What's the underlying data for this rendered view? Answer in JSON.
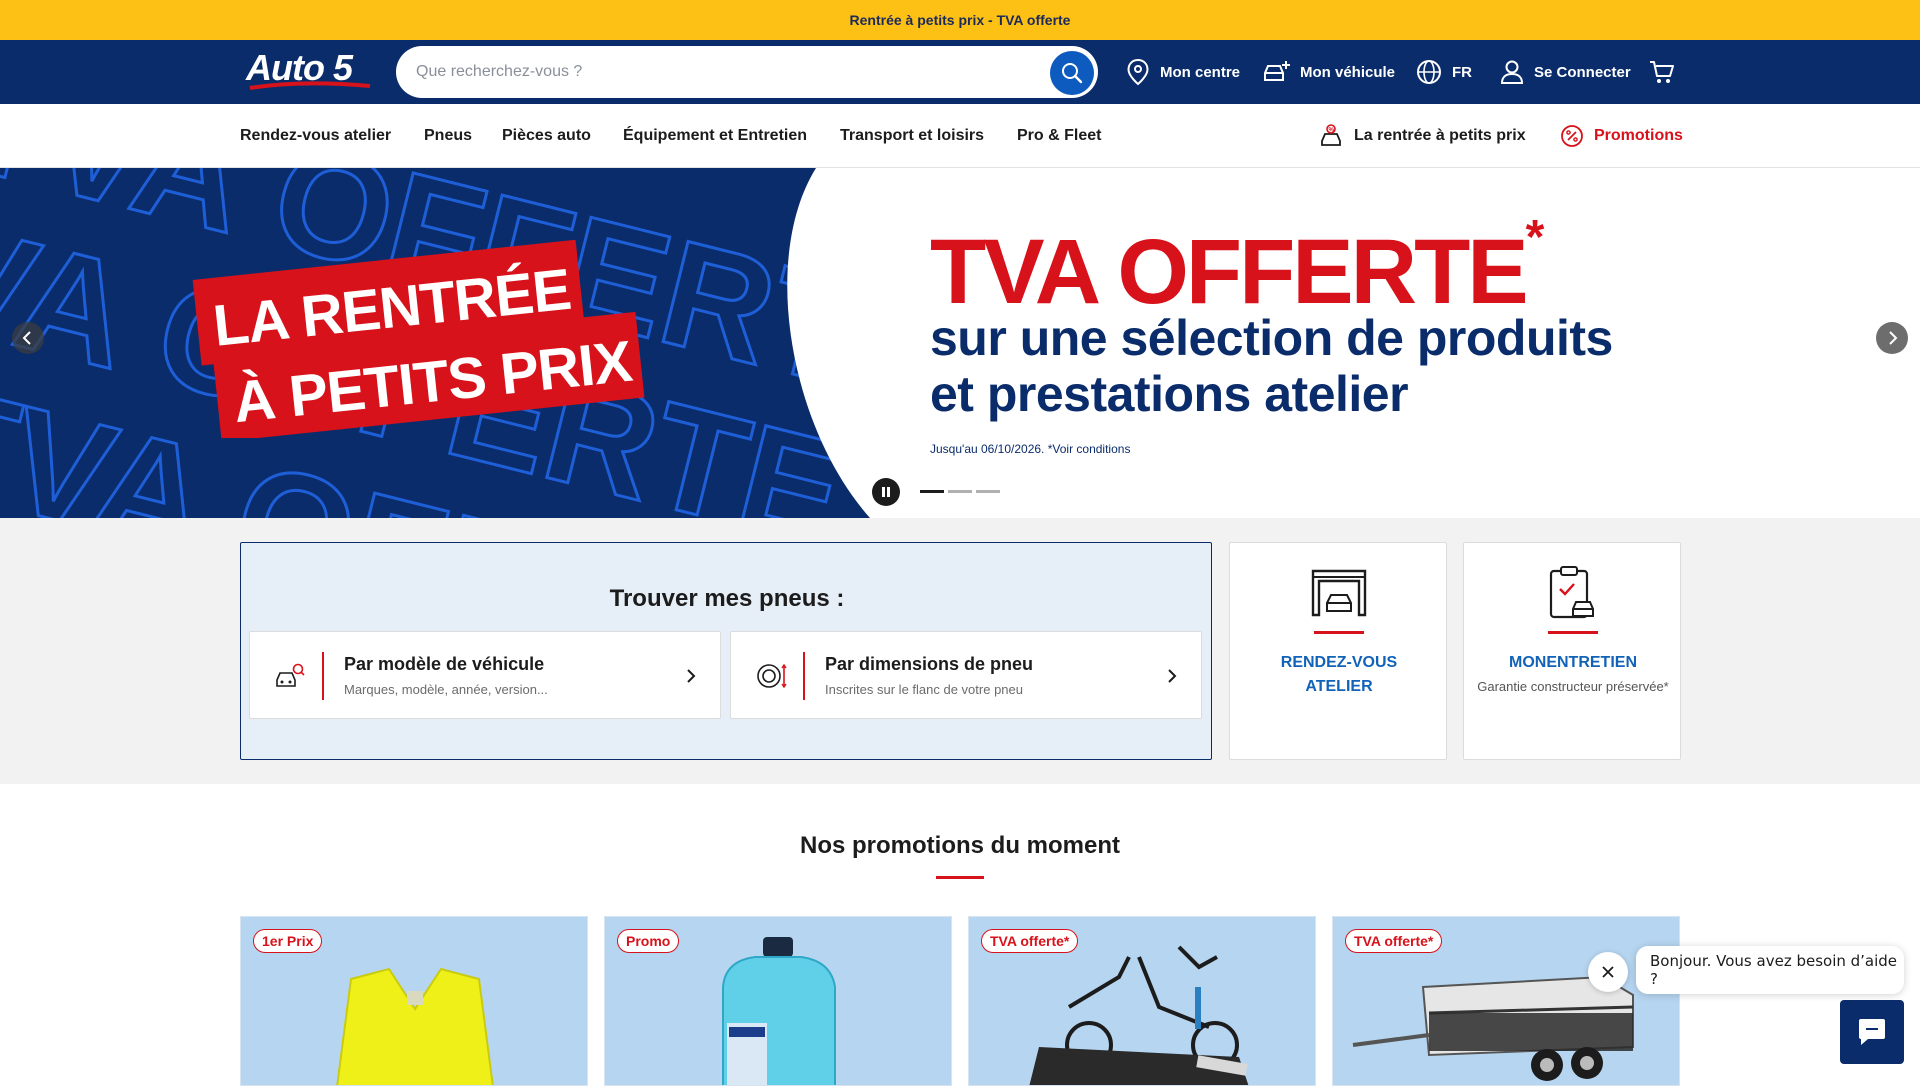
{
  "topbar": {
    "text": "Rentrée à petits prix - TVA offerte"
  },
  "header": {
    "logo_text": "Auto 5",
    "search_placeholder": "Que recherchez-vous ?",
    "mon_centre": "Mon centre",
    "mon_vehicule": "Mon véhicule",
    "language": "FR",
    "login": "Se Connecter"
  },
  "nav": {
    "items": [
      "Rendez-vous atelier",
      "Pneus",
      "Pièces auto",
      "Équipement et Entretien",
      "Transport et loisirs",
      "Pro & Fleet"
    ],
    "rentree": "La rentrée à petits prix",
    "promotions": "Promotions"
  },
  "hero": {
    "banner_line1": "LA RENTRÉE",
    "banner_line2": "À PETITS PRIX",
    "bg_text": "TVA OFFERTE",
    "title": "TVA OFFERTE",
    "asterisk": "*",
    "subtitle_line1": "sur une sélection de produits",
    "subtitle_line2": "et prestations atelier",
    "conditions": "Jusqu'au 06/10/2026. *Voir conditions"
  },
  "tyres": {
    "title": "Trouver mes pneus :",
    "option1": {
      "label": "Par modèle de véhicule",
      "sub": "Marques, modèle, année, version..."
    },
    "option2": {
      "label": "Par dimensions de pneu",
      "sub": "Inscrites sur le flanc de votre pneu"
    }
  },
  "services": {
    "rdv": {
      "line1": "RENDEZ-VOUS",
      "line2": "ATELIER"
    },
    "monentretien": {
      "title": "MONENTRETIEN",
      "sub": "Garantie constructeur préservée*"
    }
  },
  "promos": {
    "heading": "Nos promotions du moment",
    "cards": [
      {
        "badge": "1er Prix"
      },
      {
        "badge": "Promo"
      },
      {
        "badge": "TVA offerte*"
      },
      {
        "badge": "TVA offerte*"
      }
    ]
  },
  "chat": {
    "message": "Bonjour. Vous avez besoin d’aide ?"
  },
  "colors": {
    "navy": "#0b2c6b",
    "yellow": "#fcc114",
    "red": "#d8121a",
    "blue": "#0d5bbf"
  }
}
